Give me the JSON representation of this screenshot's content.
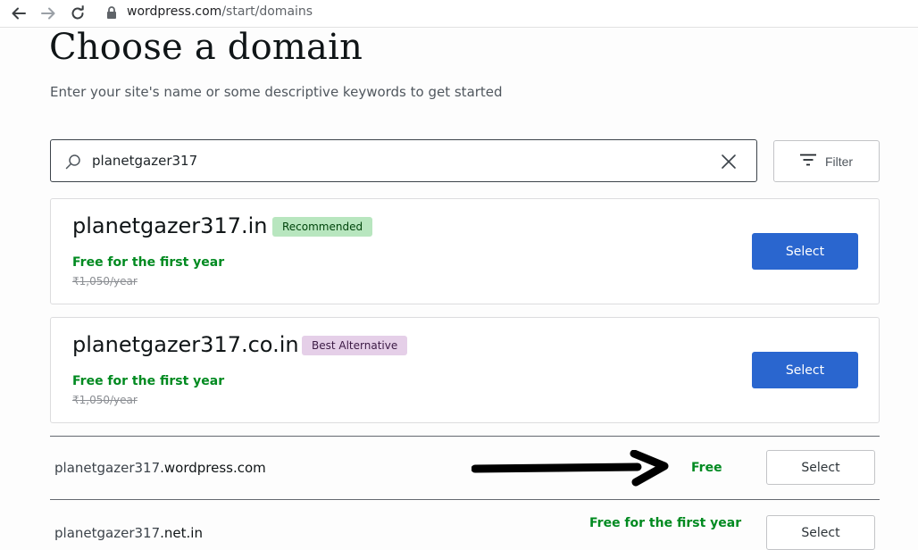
{
  "browser": {
    "url_host": "wordpress.com",
    "url_path": "/start/domains"
  },
  "page": {
    "title": "Choose a domain",
    "subtitle": "Enter your site's name or some descriptive keywords to get started"
  },
  "search": {
    "value": "planetgazer317",
    "filter_label": "Filter"
  },
  "featured": [
    {
      "domain": "planetgazer317.in",
      "badge": "Recommended",
      "price_note": "Free for the first year",
      "original_price": "₹1,050/year",
      "select_label": "Select"
    },
    {
      "domain": "planetgazer317.co.in",
      "badge": "Best Alternative",
      "price_note": "Free for the first year",
      "original_price": "₹1,050/year",
      "select_label": "Select"
    }
  ],
  "results": [
    {
      "name": "planetgazer317",
      "tld": ".wordpress.com",
      "price_note": "Free",
      "select_label": "Select"
    },
    {
      "name": "planetgazer317",
      "tld": ".net.in",
      "price_note": "Free for the first year",
      "select_label": "Select"
    }
  ],
  "colors": {
    "primary_button": "#2a66cf",
    "free_green": "#008a20",
    "recommended_badge": "#b8e6bf",
    "alternative_badge": "#e5cfe8"
  },
  "icons": [
    "back-arrow-icon",
    "forward-arrow-icon",
    "reload-icon",
    "lock-icon",
    "search-icon",
    "clear-icon",
    "filter-icon",
    "annotation-arrow-icon"
  ]
}
